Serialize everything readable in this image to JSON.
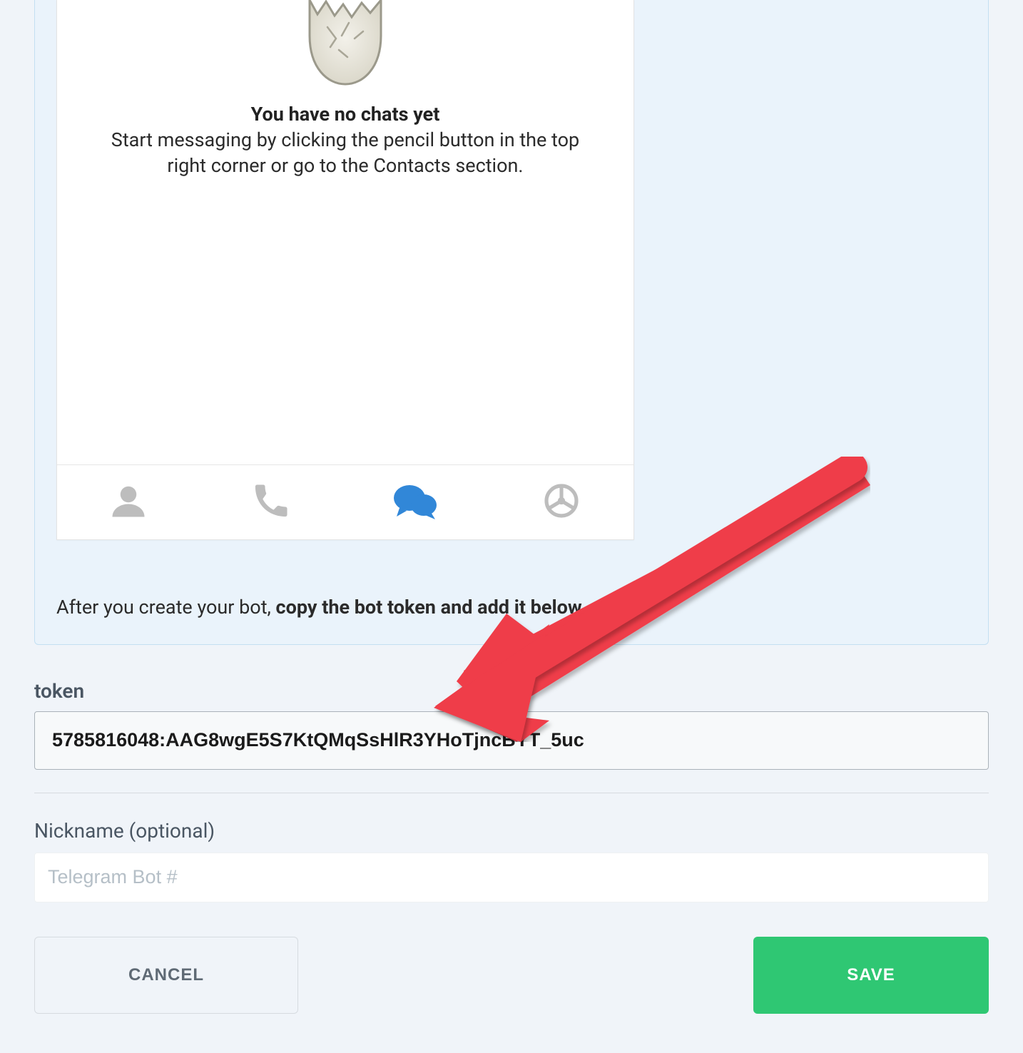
{
  "phone": {
    "empty_title": "You have no chats yet",
    "empty_desc": "Start messaging by clicking the pencil button in the top right corner or go to the Contacts section."
  },
  "instruction": {
    "prefix": "After you create your bot, ",
    "bold": "copy the bot token and add it below",
    "suffix": "."
  },
  "form": {
    "token_label": "token",
    "token_value": "5785816048:AAG8wgE5S7KtQMqSsHlR3YHoTjncBYT_5uc",
    "nickname_label": "Nickname (optional)",
    "nickname_placeholder": "Telegram Bot #",
    "cancel_label": "CANCEL",
    "save_label": "SAVE"
  }
}
